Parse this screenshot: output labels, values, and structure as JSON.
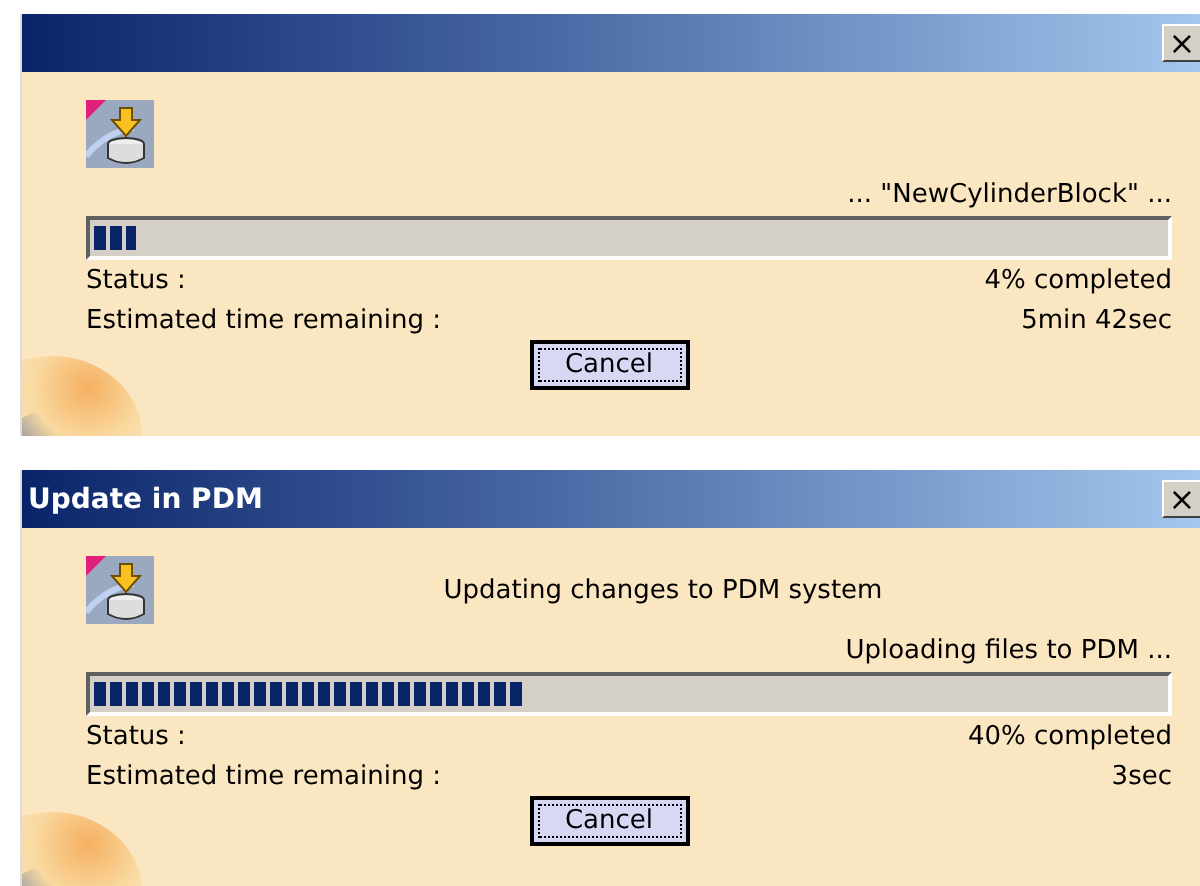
{
  "dialogs": [
    {
      "status_detail": "... \"NewCylinderBlock\" ...",
      "progress": {
        "level": 0.04
      },
      "status_label": "Status :",
      "status_value": "4% completed",
      "time_label": "Estimated time remaining :",
      "time_value": "5min 42sec",
      "close": "×",
      "button": "Cancel"
    },
    {
      "title": "Update in PDM",
      "message": "Updating changes to PDM system",
      "status_detail": "Uploading files to PDM ...",
      "progress": {
        "level": 0.4
      },
      "status_label": "Status :",
      "status_value": "40% completed",
      "time_label": "Estimated time remaining :",
      "time_value": "3sec",
      "close": "×",
      "button": "Cancel"
    }
  ]
}
